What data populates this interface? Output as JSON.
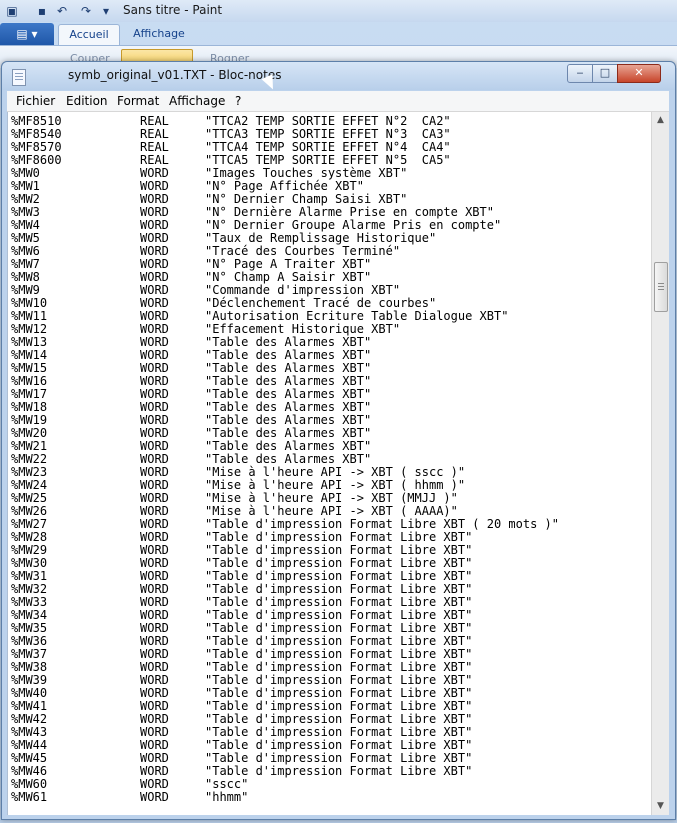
{
  "paint": {
    "title": "Sans titre - Paint",
    "menu_button": "▤ ▾",
    "tabs": [
      "Accueil",
      "Affichage"
    ],
    "ghost_labels": [
      "Couper",
      "Rogner"
    ]
  },
  "notepad": {
    "title": "symb_original_v01.TXT - Bloc-notes",
    "menus": [
      "Fichier",
      "Edition",
      "Format",
      "Affichage",
      "?"
    ],
    "window_buttons": {
      "minimize": "‒",
      "maximize": "□",
      "close": "✕"
    },
    "rows": [
      {
        "sym": "%MF8510",
        "type": "REAL",
        "com": "\"TTCA2 TEMP SORTIE EFFET N°2  CA2\""
      },
      {
        "sym": "%MF8540",
        "type": "REAL",
        "com": "\"TTCA3 TEMP SORTIE EFFET N°3  CA3\""
      },
      {
        "sym": "%MF8570",
        "type": "REAL",
        "com": "\"TTCA4 TEMP SORTIE EFFET N°4  CA4\""
      },
      {
        "sym": "%MF8600",
        "type": "REAL",
        "com": "\"TTCA5 TEMP SORTIE EFFET N°5  CA5\""
      },
      {
        "sym": "%MW0",
        "type": "WORD",
        "com": "\"Images Touches système XBT\""
      },
      {
        "sym": "%MW1",
        "type": "WORD",
        "com": "\"N° Page Affichée XBT\""
      },
      {
        "sym": "%MW2",
        "type": "WORD",
        "com": "\"N° Dernier Champ Saisi XBT\""
      },
      {
        "sym": "%MW3",
        "type": "WORD",
        "com": "\"N° Dernière Alarme Prise en compte XBT\""
      },
      {
        "sym": "%MW4",
        "type": "WORD",
        "com": "\"N° Dernier Groupe Alarme Pris en compte\""
      },
      {
        "sym": "%MW5",
        "type": "WORD",
        "com": "\"Taux de Remplissage Historique\""
      },
      {
        "sym": "%MW6",
        "type": "WORD",
        "com": "\"Tracé des Courbes Terminé\""
      },
      {
        "sym": "%MW7",
        "type": "WORD",
        "com": "\"N° Page A Traiter XBT\""
      },
      {
        "sym": "%MW8",
        "type": "WORD",
        "com": "\"N° Champ A Saisir XBT\""
      },
      {
        "sym": "%MW9",
        "type": "WORD",
        "com": "\"Commande d'impression XBT\""
      },
      {
        "sym": "%MW10",
        "type": "WORD",
        "com": "\"Déclenchement Tracé de courbes\""
      },
      {
        "sym": "%MW11",
        "type": "WORD",
        "com": "\"Autorisation Ecriture Table Dialogue XBT\""
      },
      {
        "sym": "%MW12",
        "type": "WORD",
        "com": "\"Effacement Historique XBT\""
      },
      {
        "sym": "%MW13",
        "type": "WORD",
        "com": "\"Table des Alarmes XBT\""
      },
      {
        "sym": "%MW14",
        "type": "WORD",
        "com": "\"Table des Alarmes XBT\""
      },
      {
        "sym": "%MW15",
        "type": "WORD",
        "com": "\"Table des Alarmes XBT\""
      },
      {
        "sym": "%MW16",
        "type": "WORD",
        "com": "\"Table des Alarmes XBT\""
      },
      {
        "sym": "%MW17",
        "type": "WORD",
        "com": "\"Table des Alarmes XBT\""
      },
      {
        "sym": "%MW18",
        "type": "WORD",
        "com": "\"Table des Alarmes XBT\""
      },
      {
        "sym": "%MW19",
        "type": "WORD",
        "com": "\"Table des Alarmes XBT\""
      },
      {
        "sym": "%MW20",
        "type": "WORD",
        "com": "\"Table des Alarmes XBT\""
      },
      {
        "sym": "%MW21",
        "type": "WORD",
        "com": "\"Table des Alarmes XBT\""
      },
      {
        "sym": "%MW22",
        "type": "WORD",
        "com": "\"Table des Alarmes XBT\""
      },
      {
        "sym": "%MW23",
        "type": "WORD",
        "com": "\"Mise à l'heure API -> XBT ( sscc )\""
      },
      {
        "sym": "%MW24",
        "type": "WORD",
        "com": "\"Mise à l'heure API -> XBT ( hhmm )\""
      },
      {
        "sym": "%MW25",
        "type": "WORD",
        "com": "\"Mise à l'heure API -> XBT (MMJJ )\""
      },
      {
        "sym": "%MW26",
        "type": "WORD",
        "com": "\"Mise à l'heure API -> XBT ( AAAA)\""
      },
      {
        "sym": "%MW27",
        "type": "WORD",
        "com": "\"Table d'impression Format Libre XBT ( 20 mots )\""
      },
      {
        "sym": "%MW28",
        "type": "WORD",
        "com": "\"Table d'impression Format Libre XBT\""
      },
      {
        "sym": "%MW29",
        "type": "WORD",
        "com": "\"Table d'impression Format Libre XBT\""
      },
      {
        "sym": "%MW30",
        "type": "WORD",
        "com": "\"Table d'impression Format Libre XBT\""
      },
      {
        "sym": "%MW31",
        "type": "WORD",
        "com": "\"Table d'impression Format Libre XBT\""
      },
      {
        "sym": "%MW32",
        "type": "WORD",
        "com": "\"Table d'impression Format Libre XBT\""
      },
      {
        "sym": "%MW33",
        "type": "WORD",
        "com": "\"Table d'impression Format Libre XBT\""
      },
      {
        "sym": "%MW34",
        "type": "WORD",
        "com": "\"Table d'impression Format Libre XBT\""
      },
      {
        "sym": "%MW35",
        "type": "WORD",
        "com": "\"Table d'impression Format Libre XBT\""
      },
      {
        "sym": "%MW36",
        "type": "WORD",
        "com": "\"Table d'impression Format Libre XBT\""
      },
      {
        "sym": "%MW37",
        "type": "WORD",
        "com": "\"Table d'impression Format Libre XBT\""
      },
      {
        "sym": "%MW38",
        "type": "WORD",
        "com": "\"Table d'impression Format Libre XBT\""
      },
      {
        "sym": "%MW39",
        "type": "WORD",
        "com": "\"Table d'impression Format Libre XBT\""
      },
      {
        "sym": "%MW40",
        "type": "WORD",
        "com": "\"Table d'impression Format Libre XBT\""
      },
      {
        "sym": "%MW41",
        "type": "WORD",
        "com": "\"Table d'impression Format Libre XBT\""
      },
      {
        "sym": "%MW42",
        "type": "WORD",
        "com": "\"Table d'impression Format Libre XBT\""
      },
      {
        "sym": "%MW43",
        "type": "WORD",
        "com": "\"Table d'impression Format Libre XBT\""
      },
      {
        "sym": "%MW44",
        "type": "WORD",
        "com": "\"Table d'impression Format Libre XBT\""
      },
      {
        "sym": "%MW45",
        "type": "WORD",
        "com": "\"Table d'impression Format Libre XBT\""
      },
      {
        "sym": "%MW46",
        "type": "WORD",
        "com": "\"Table d'impression Format Libre XBT\""
      },
      {
        "sym": "%MW60",
        "type": "WORD",
        "com": "\"sscc\""
      },
      {
        "sym": "%MW61",
        "type": "WORD",
        "com": "\"hhmm\""
      }
    ]
  }
}
